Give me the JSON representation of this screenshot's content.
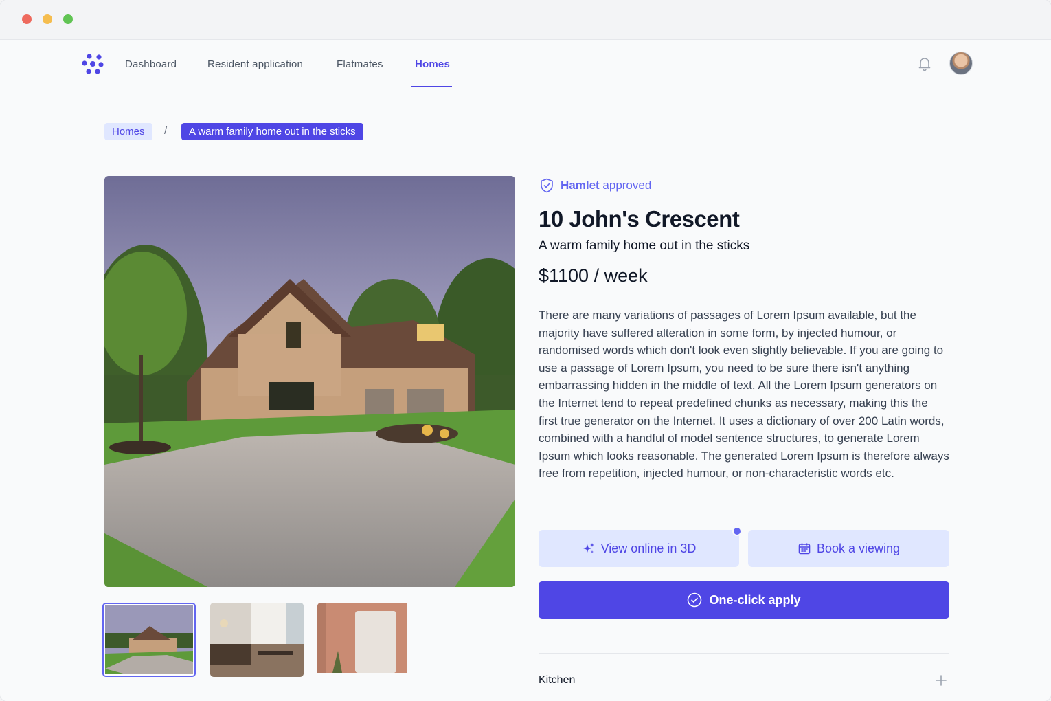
{
  "nav": {
    "items": [
      {
        "label": "Dashboard"
      },
      {
        "label": "Resident application"
      },
      {
        "label": "Flatmates"
      },
      {
        "label": "Homes"
      }
    ],
    "active": "Homes"
  },
  "breadcrumb": {
    "home": "Homes",
    "separator": "/",
    "current": "A warm family home out in the sticks"
  },
  "listing": {
    "badge_bold": "Hamlet",
    "badge_rest": " approved",
    "title": "10 John's Crescent",
    "subtitle": "A warm family home out in the sticks",
    "price": "$1100 / week",
    "description": "There are many variations of passages of Lorem Ipsum available, but the majority have suffered alteration in some form, by injected humour, or randomised words which don't look even slightly believable. If you are going to use a passage of Lorem Ipsum, you need to be sure there isn't anything embarrassing hidden in the middle of text. All the Lorem Ipsum generators on the Internet tend to repeat predefined chunks as necessary, making this the first true generator on the Internet. It uses a dictionary of over 200 Latin words, combined with a handful of model sentence structures, to generate Lorem Ipsum which looks reasonable. The generated Lorem Ipsum is therefore always free from repetition, injected humour, or non-characteristic words etc."
  },
  "actions": {
    "view_3d": "View online in 3D",
    "book_viewing": "Book a viewing",
    "apply": "One-click apply"
  },
  "accordion": {
    "kitchen": "Kitchen"
  },
  "icons": {
    "logo": "hamlet-logo-icon",
    "bell": "bell-icon",
    "badge": "shield-check-icon",
    "sparkles": "sparkles-icon",
    "calendar": "calendar-icon",
    "check": "check-circle-icon",
    "plus": "plus-icon"
  },
  "colors": {
    "accent": "#4f46e5",
    "accent_light": "#e0e7ff",
    "background": "#f9fafb"
  }
}
